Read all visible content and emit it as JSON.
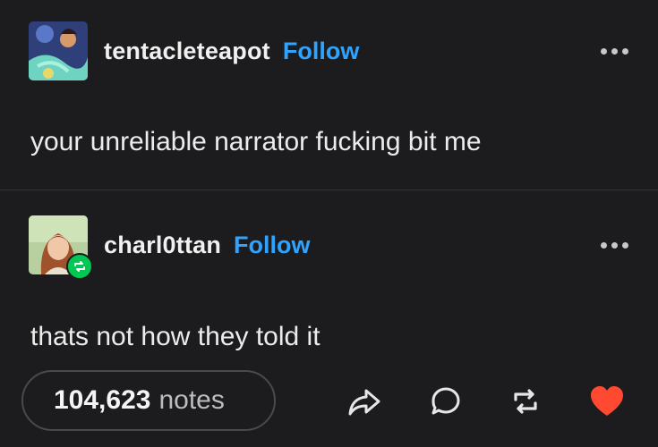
{
  "posts": [
    {
      "username": "tentacleteapot",
      "follow_label": "Follow",
      "text": "your unreliable narrator fucking bit me",
      "avatar_icon": "artwork-avatar",
      "reblogged": false
    },
    {
      "username": "charl0ttan",
      "follow_label": "Follow",
      "text": "thats not how they told it",
      "avatar_icon": "portrait-avatar",
      "reblogged": true
    }
  ],
  "footer": {
    "notes_count": "104,623",
    "notes_label": "notes",
    "actions": [
      "share-icon",
      "reply-icon",
      "reblog-icon",
      "like-icon"
    ]
  },
  "colors": {
    "background": "#1c1c1e",
    "follow": "#2ea3ff",
    "reblog_badge": "#00c853",
    "like": "#ff4930"
  }
}
